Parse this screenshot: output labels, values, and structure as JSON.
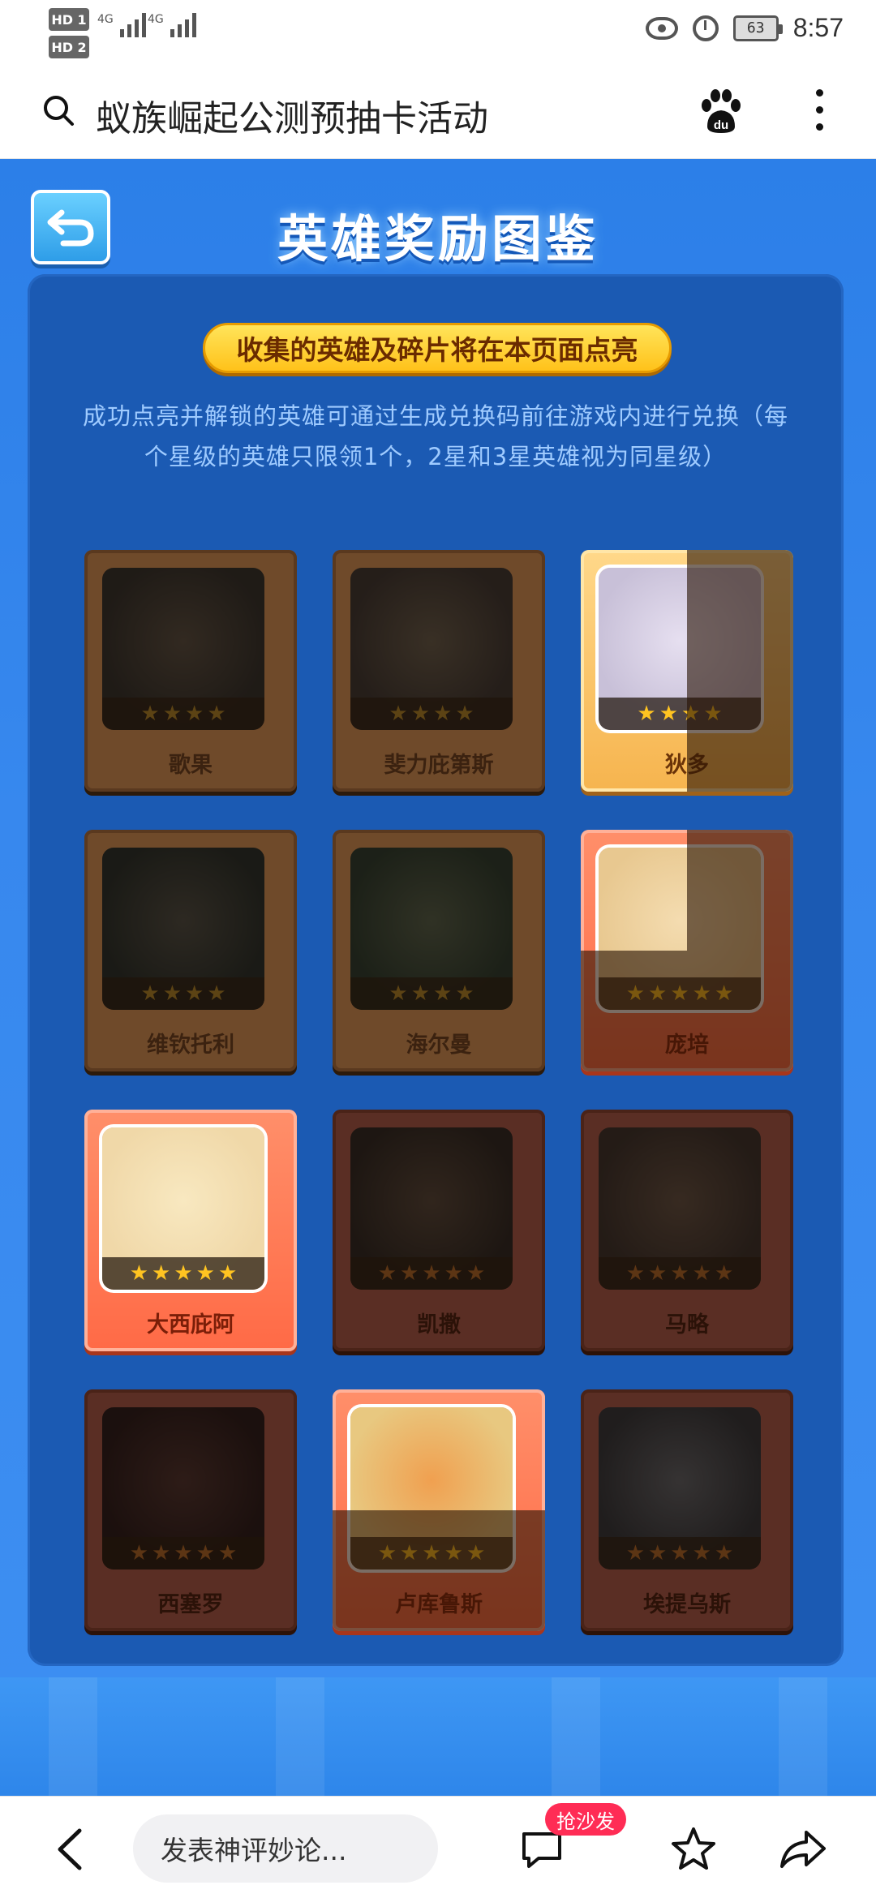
{
  "status_bar": {
    "hd1": "HD 1",
    "hd2": "HD 2",
    "net1": "4G",
    "net2": "4G",
    "battery": "63",
    "time": "8:57"
  },
  "search": {
    "query": "蚁族崛起公测预抽卡活动"
  },
  "game": {
    "title": "英雄奖励图鉴",
    "notice": "收集的英雄及碎片将在本页面点亮",
    "description": "成功点亮并解锁的英雄可通过生成兑换码前往游戏内进行兑换（每个星级的英雄只限领1个，2星和3星英雄视为同星级）",
    "heroes": [
      {
        "name": "歌果",
        "stars": 4,
        "state": "locked"
      },
      {
        "name": "斐力庇第斯",
        "stars": 4,
        "state": "locked"
      },
      {
        "name": "狄多",
        "stars": 4,
        "state": "half-gold"
      },
      {
        "name": "维钦托利",
        "stars": 4,
        "state": "locked"
      },
      {
        "name": "海尔曼",
        "stars": 4,
        "state": "locked"
      },
      {
        "name": "庞培",
        "stars": 5,
        "state": "half-red"
      },
      {
        "name": "大西庇阿",
        "stars": 5,
        "state": "unlocked-red"
      },
      {
        "name": "凯撒",
        "stars": 5,
        "state": "locked-red"
      },
      {
        "name": "马略",
        "stars": 5,
        "state": "locked-red"
      },
      {
        "name": "西塞罗",
        "stars": 5,
        "state": "locked-red"
      },
      {
        "name": "卢库鲁斯",
        "stars": 5,
        "state": "half-red"
      },
      {
        "name": "埃提乌斯",
        "stars": 5,
        "state": "locked-red"
      }
    ]
  },
  "toolbar": {
    "comment_placeholder": "发表神评妙论...",
    "badge": "抢沙发"
  }
}
